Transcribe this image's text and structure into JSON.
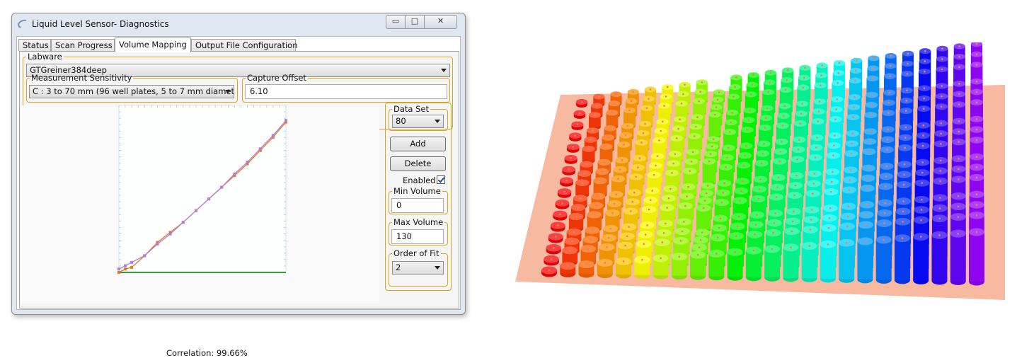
{
  "window": {
    "title": "Liquid Level Sensor- Diagnostics",
    "controls": {
      "minimize": "▭",
      "maximize": "□",
      "close": "✕"
    }
  },
  "tabs": [
    "Status",
    "Scan Progress",
    "Volume Mapping",
    "Output File Configuration"
  ],
  "active_tab": "Volume Mapping",
  "labware": {
    "label": "Labware",
    "value": "GTGreiner384deep"
  },
  "measurement_sensitivity": {
    "label": "Measurement Sensitivity",
    "value": "C : 3 to 70 mm (96 well plates, 5 to 7 mm diamete"
  },
  "capture_offset": {
    "label": "Capture Offset",
    "value": "6.10"
  },
  "data_set": {
    "label": "Data Set",
    "value": "80"
  },
  "buttons": {
    "add": "Add",
    "delete": "Delete"
  },
  "enabled": {
    "label": "Enabled",
    "checked": true
  },
  "min_volume": {
    "label": "Min Volume",
    "value": "0"
  },
  "max_volume": {
    "label": "Max Volume",
    "value": "130"
  },
  "order_of_fit": {
    "label": "Order of Fit",
    "value": "2"
  },
  "correlation": "Correlation: 99.66%",
  "colors": {
    "groupbox_border": "#d9a520",
    "measured_series": "#e07b24",
    "fit_series": "#b27ed9",
    "baseline": "#3a9a3a",
    "plate_base": "#f7b9a0"
  },
  "chart_data": {
    "type": "line",
    "title": "",
    "xlabel": "",
    "ylabel": "",
    "xlim": [
      0,
      130
    ],
    "ylim": [
      0,
      100
    ],
    "grid": false,
    "series": [
      {
        "x": [
          0,
          5,
          10,
          20,
          30,
          40,
          50,
          60,
          70,
          80,
          90,
          100,
          110,
          120,
          130
        ],
        "values": [
          0,
          2,
          3,
          10,
          18,
          24,
          30,
          37,
          44,
          51,
          58,
          65,
          73,
          81,
          90
        ]
      },
      {
        "x": [
          0,
          5,
          10,
          20,
          30,
          40,
          50,
          60,
          70,
          80,
          90,
          100,
          110,
          120,
          130
        ],
        "values": [
          2,
          4,
          6,
          10,
          17,
          23,
          30,
          37,
          44,
          51,
          59,
          66,
          74,
          82,
          91
        ]
      }
    ]
  },
  "plate3d": {
    "rows": 16,
    "cols": 24,
    "description_free": true
  }
}
